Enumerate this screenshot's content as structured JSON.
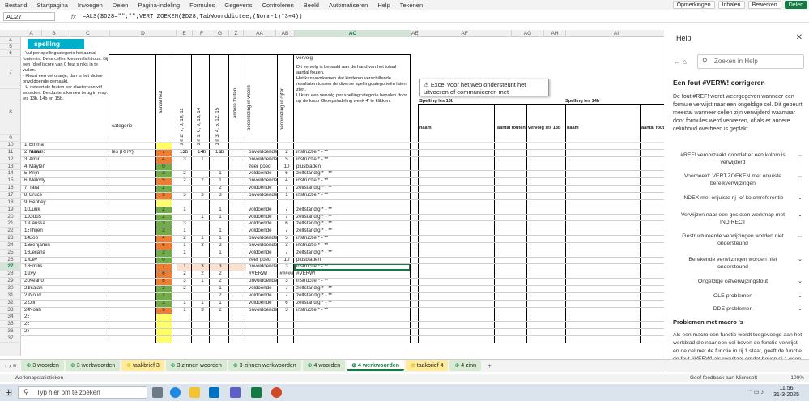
{
  "menu": [
    "Bestand",
    "Startpagina",
    "Invoegen",
    "Delen",
    "Pagina-indeling",
    "Formules",
    "Gegevens",
    "Controleren",
    "Beeld",
    "Automatiseren",
    "Help",
    "Tekenen"
  ],
  "menu_right": {
    "comments": "Opmerkingen",
    "catch_up": "Inhalen",
    "edit": "Bewerken",
    "share": "Delen"
  },
  "name_box": "AC27",
  "fx": "fx",
  "formula": "=ALS($D28=\"\";\"\";VERT.ZOEKEN($D28;TabWoorddictee;(Norm-1)*3+4))",
  "col_headers": [
    "A",
    "B",
    "C",
    "D",
    "E",
    "F",
    "G",
    "Z",
    "AA",
    "AB",
    "AC",
    "AE",
    "AF",
    "AG",
    "AH",
    "AI",
    "AJ"
  ],
  "row_headers": [
    "4",
    "5",
    "6",
    "7",
    "8",
    "9",
    "10",
    "11",
    "12",
    "13",
    "14",
    "15",
    "16",
    "17",
    "18",
    "19",
    "20",
    "21",
    "22",
    "23",
    "24",
    "25",
    "26",
    "27",
    "28",
    "29",
    "30",
    "31",
    "32",
    "33",
    "34",
    "35",
    "36",
    "37"
  ],
  "sheet": {
    "title": "spelling",
    "instructions": "- Vul per spellingcategorie het aantal fouten in. Deze cellen kleuren lichtroos. Bij een (deel)score van 0 fout s niks in te vullen.\n- Kleurt een cel oranje, dan is het dictee onvoldoende gemaakt.\n- U noteert de fouten per cluster van vijf woorden. De clusters komen terug in resp. les 13b, 14b en 15b.",
    "categorie": "categorie",
    "aantal_fout": "aantal fout",
    "cols_e": "zin 2, 7, 8, 10, 11",
    "cols_f": "zin 1, 6, 9, 13, 14",
    "cols_g": "zin 3, 4, 5, 12, 15",
    "andere_fouten": "andere fouten",
    "beoordeling_woord": "beoordeling in woord",
    "beoordeling_cijfer": "beoordeling in cijfer",
    "vervolg": "vervolg",
    "vervolg_text": "Dit vervolg is bepaald aan de hand van het totaal aantal fouten.\nHet kan voorkomen dat kinderen verschillende resultaten tussen de diverse spellingcategorieën laten zien.\nU kunt een vervolg per spellingcategorie bepalen door op de knop 'Groepsindeling week 4' te klikken.",
    "naam": "naam:",
    "les": "les (RHV)",
    "les_cols": [
      "13b",
      "14b",
      "15b"
    ],
    "spelling13b": "Spelling les 13b",
    "spelling14b": "Spelling les 14b",
    "naam2": "naam",
    "aantal_fouten": "aantal fouten",
    "vervolg13b": "vervolg les 13b",
    "note": "Excel voor het web ondersteunt het uitvoeren of communiceren met",
    "students": [
      {
        "n": "1",
        "name": "Emma",
        "d": "",
        "e": "",
        "f": "",
        "g": "",
        "aa": "",
        "ab": "",
        "ac": "",
        "c": ""
      },
      {
        "n": "2",
        "name": "Maria",
        "d": "7",
        "e": "2",
        "f": "4",
        "g": "1",
        "aa": "onvoldoende",
        "ab": "2",
        "ac": "instructie * - **",
        "c": "o"
      },
      {
        "n": "3",
        "name": "Amir",
        "d": "4",
        "e": "3",
        "f": "1",
        "g": "",
        "aa": "onvoldoende",
        "ab": "5",
        "ac": "instructie * - **",
        "c": "o"
      },
      {
        "n": "4",
        "name": "Maylen",
        "d": "0",
        "e": "",
        "f": "",
        "g": "",
        "aa": "zeer goed",
        "ab": "10",
        "ac": "plusbladen",
        "c": "g"
      },
      {
        "n": "5",
        "name": "Krijn",
        "d": "3",
        "e": "2",
        "f": "",
        "g": "1",
        "aa": "voldoende",
        "ab": "6",
        "ac": "zelfstandig * - **",
        "c": "g"
      },
      {
        "n": "6",
        "name": "Melody",
        "d": "5",
        "e": "2",
        "f": "2",
        "g": "1",
        "aa": "onvoldoende",
        "ab": "4",
        "ac": "instructie * - **",
        "c": "o"
      },
      {
        "n": "7",
        "name": "Tara",
        "d": "2",
        "e": "",
        "f": "",
        "g": "2",
        "aa": "voldoende",
        "ab": "7",
        "ac": "zelfstandig * - **",
        "c": "g"
      },
      {
        "n": "8",
        "name": "Bruce",
        "d": "9",
        "e": "3",
        "f": "3",
        "g": "3",
        "aa": "onvoldoende",
        "ab": "1",
        "ac": "instructie * - **",
        "c": "o"
      },
      {
        "n": "9",
        "name": "Bentley",
        "d": "",
        "e": "",
        "f": "",
        "g": "",
        "aa": "",
        "ab": "",
        "ac": "",
        "c": ""
      },
      {
        "n": "10",
        "name": "Luuk",
        "d": "2",
        "e": "1",
        "f": "",
        "g": "1",
        "aa": "voldoende",
        "ab": "7",
        "ac": "zelfstandig * - **",
        "c": "g"
      },
      {
        "n": "11",
        "name": "Guus",
        "d": "2",
        "e": "",
        "f": "1",
        "g": "1",
        "aa": "voldoende",
        "ab": "7",
        "ac": "zelfstandig * - **",
        "c": "g"
      },
      {
        "n": "12",
        "name": "Larissa",
        "d": "3",
        "e": "3",
        "f": "",
        "g": "",
        "aa": "voldoende",
        "ab": "6",
        "ac": "zelfstandig * - **",
        "c": "g"
      },
      {
        "n": "13",
        "name": "Thijen",
        "d": "2",
        "e": "1",
        "f": "",
        "g": "1",
        "aa": "voldoende",
        "ab": "7",
        "ac": "zelfstandig * - **",
        "c": "g"
      },
      {
        "n": "14",
        "name": "Bob",
        "d": "4",
        "e": "2",
        "f": "1",
        "g": "1",
        "aa": "onvoldoende",
        "ab": "5",
        "ac": "instructie * - **",
        "c": "o"
      },
      {
        "n": "15",
        "name": "Benjamin",
        "d": "6",
        "e": "1",
        "f": "3",
        "g": "2",
        "aa": "onvoldoende",
        "ab": "3",
        "ac": "instructie * - **",
        "c": "o"
      },
      {
        "n": "16",
        "name": "Leilana",
        "d": "2",
        "e": "1",
        "f": "",
        "g": "1",
        "aa": "voldoende",
        "ab": "7",
        "ac": "zelfstandig * - **",
        "c": "g"
      },
      {
        "n": "17",
        "name": "Lev",
        "d": "0",
        "e": "",
        "f": "",
        "g": "",
        "aa": "zeer goed",
        "ab": "10",
        "ac": "plusbladen",
        "c": "g"
      },
      {
        "n": "18",
        "name": "Emilis",
        "d": "7",
        "e": "1",
        "f": "3",
        "g": "3",
        "aa": "onvoldoende",
        "ab": "3",
        "ac": "instructie * - **",
        "c": "o"
      },
      {
        "n": "19",
        "name": "Ivy",
        "d": "6",
        "e": "2",
        "f": "2",
        "g": "2",
        "aa": "#VERW!",
        "ab": "#####",
        "ac": "#VERW!",
        "c": "o"
      },
      {
        "n": "20",
        "name": "Keano",
        "d": "6",
        "e": "3",
        "f": "1",
        "g": "2",
        "aa": "onvoldoende",
        "ab": "3",
        "ac": "instructie * - **",
        "c": "o"
      },
      {
        "n": "21",
        "name": "Isaiah",
        "d": "2",
        "e": "2",
        "f": "",
        "g": "1",
        "aa": "voldoende",
        "ab": "7",
        "ac": "zelfstandig * - **",
        "c": "g"
      },
      {
        "n": "22",
        "name": "Noud",
        "d": "2",
        "e": "",
        "f": "",
        "g": "2",
        "aa": "voldoende",
        "ab": "7",
        "ac": "zelfstandig * - **",
        "c": "g"
      },
      {
        "n": "23",
        "name": "Jili",
        "d": "3",
        "e": "1",
        "f": "1",
        "g": "1",
        "aa": "voldoende",
        "ab": "6",
        "ac": "zelfstandig * - **",
        "c": "g"
      },
      {
        "n": "24",
        "name": "Noah",
        "d": "6",
        "e": "1",
        "f": "3",
        "g": "2",
        "aa": "onvoldoende",
        "ab": "3",
        "ac": "instructie * - **",
        "c": "o"
      },
      {
        "n": "25",
        "name": "",
        "d": "",
        "e": "",
        "f": "",
        "g": "",
        "aa": "",
        "ab": "",
        "ac": "",
        "c": ""
      },
      {
        "n": "26",
        "name": "",
        "d": "",
        "e": "",
        "f": "",
        "g": "",
        "aa": "",
        "ab": "",
        "ac": "",
        "c": ""
      },
      {
        "n": "27",
        "name": "",
        "d": "",
        "e": "",
        "f": "",
        "g": "",
        "aa": "",
        "ab": "",
        "ac": "",
        "c": ""
      }
    ]
  },
  "help": {
    "title": "Help",
    "search_placeholder": "Zoeken in Help",
    "heading": "Een fout #VERW! corrigeren",
    "body": "De fout #REF! wordt weergegeven wanneer een formule verwijst naar een ongeldige cel. Dit gebeurt meestal wanneer cellen zijn verwijderd waarnaar door formules werd verwezen, of als er andere celinhoud overheen is geplakt.",
    "items": [
      "#REF! veroorzaakt doordat er een kolom is verwijderd",
      "Voorbeeld: VERT.ZOEKEN met onjuiste bereikverwijzingen",
      "INDEX met onjuiste rij- of kolomreferentie",
      "Verwijzen naar een gesloten werkmap met INDIRECT",
      "Gestructureerde verwijzingen worden niet ondersteund",
      "Berekende verwijzingen worden niet ondersteund",
      "Ongeldige celverwijzingsfout",
      "OLE-problemen",
      "DDE-problemen"
    ],
    "heading2": "Problemen met macro 's",
    "body2": "Als een macro een functie wordt toegevoegd aan het werkblad die naar een cel boven de functie verwijst en de cel met de functie in rij 1 staat, geeft de functie de fout #VERW! als resultaat omdat boven rij 1 geen"
  },
  "tabs": [
    "3 woorden",
    "3 werkwoorden",
    "taakbrief 3",
    "3 zinnen woorden",
    "3 zinnen werkwoorden",
    "4 woorden",
    "4 werkwoorden",
    "taakbrief 4",
    "4 zinn"
  ],
  "active_tab": "4 werkwoorden",
  "status": {
    "left": "Werkmapstatistieken",
    "feedback": "Geef feedback aan Microsoft",
    "zoom": "100%"
  },
  "taskbar": {
    "search": "Typ hier om te zoeken",
    "time": "11:56",
    "date": "31-3-2025"
  },
  "colors": {
    "accent": "#107c41",
    "green": "#70ad47",
    "orange": "#ed7d31",
    "yellow": "#ffff66",
    "header_bg": "#00b0c8",
    "link": "#b4c7e7"
  }
}
